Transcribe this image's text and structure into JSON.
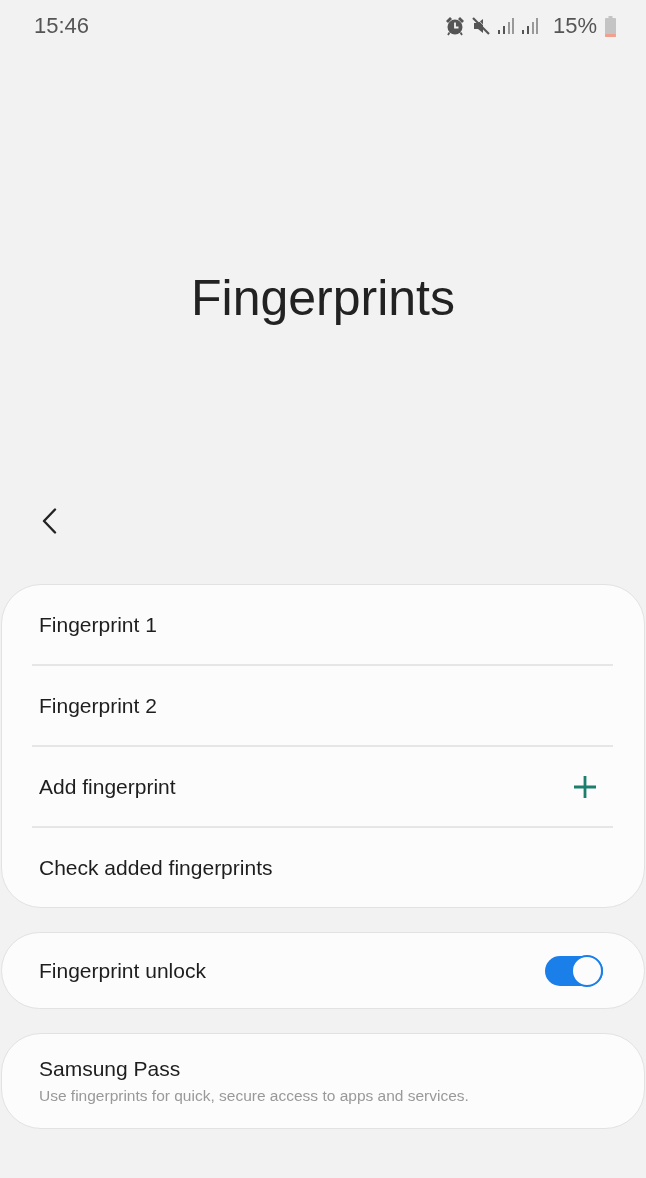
{
  "status_bar": {
    "time": "15:46",
    "battery": "15%"
  },
  "title": "Fingerprints",
  "sections": [
    {
      "items": [
        {
          "kind": "plain",
          "label": "Fingerprint 1"
        },
        {
          "kind": "plain",
          "label": "Fingerprint 2"
        },
        {
          "kind": "add",
          "label": "Add fingerprint"
        },
        {
          "kind": "plain",
          "label": "Check added fingerprints"
        }
      ]
    },
    {
      "items": [
        {
          "kind": "switch",
          "label": "Fingerprint unlock",
          "on": true
        }
      ]
    },
    {
      "items": [
        {
          "kind": "detail",
          "label": "Samsung Pass",
          "description": "Use fingerprints for quick, secure access to apps and services."
        }
      ]
    }
  ]
}
